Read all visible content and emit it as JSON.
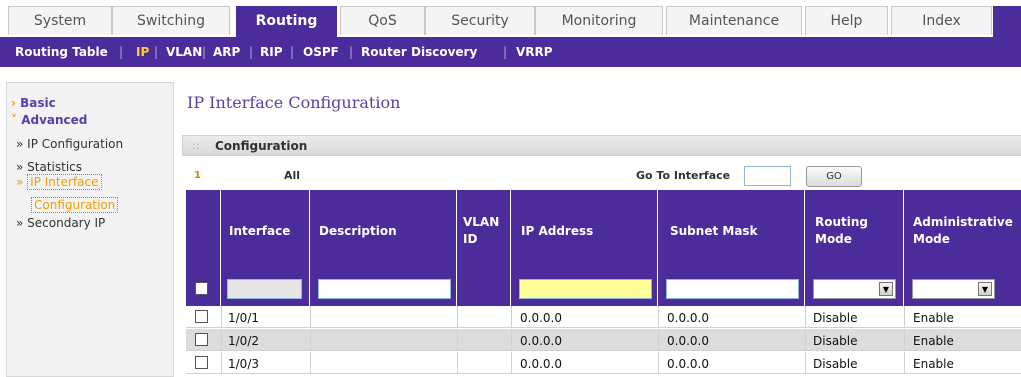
{
  "top_tabs": [
    "System",
    "Switching",
    "Routing",
    "QoS",
    "Security",
    "Monitoring",
    "Maintenance",
    "Help",
    "Index"
  ],
  "active_top_tab": "Routing",
  "subnav": [
    "Routing Table",
    "IP",
    "VLAN",
    "ARP",
    "RIP",
    "OSPF",
    "Router Discovery",
    "VRRP"
  ],
  "active_subnav": "IP",
  "sidebar": {
    "basic": "Basic",
    "advanced": "Advanced",
    "items": [
      "» IP Configuration",
      "» Statistics",
      "IP Interface",
      "Configuration",
      "» Secondary IP"
    ],
    "active_prefix": "»"
  },
  "page_title": "IP Interface Configuration",
  "panel": {
    "dots": "::",
    "title": "Configuration",
    "page_number": "1",
    "all_label": "All",
    "goto_label": "Go To Interface",
    "go_button": "GO"
  },
  "table": {
    "columns": [
      "Interface",
      "Description",
      "VLAN ID",
      "IP Address",
      "Subnet Mask",
      "Routing Mode",
      "Administrative Mode"
    ],
    "columns_wrapped": {
      "vlan_1": "VLAN",
      "vlan_2": "ID",
      "routing_1": "Routing",
      "routing_2": "Mode",
      "admin_1": "Administrative",
      "admin_2": "Mode"
    },
    "rows": [
      {
        "interface": "1/0/1",
        "description": "",
        "vlan_id": "",
        "ip": "0.0.0.0",
        "mask": "0.0.0.0",
        "routing": "Disable",
        "admin": "Enable"
      },
      {
        "interface": "1/0/2",
        "description": "",
        "vlan_id": "",
        "ip": "0.0.0.0",
        "mask": "0.0.0.0",
        "routing": "Disable",
        "admin": "Enable"
      },
      {
        "interface": "1/0/3",
        "description": "",
        "vlan_id": "",
        "ip": "0.0.0.0",
        "mask": "0.0.0.0",
        "routing": "Disable",
        "admin": "Enable"
      }
    ]
  },
  "colors": {
    "brand_purple": "#4b2c9a",
    "accent_orange": "#f0a000",
    "active_sub_yellow": "#ffcc33",
    "ip_filter_yellow": "#ffff99"
  }
}
